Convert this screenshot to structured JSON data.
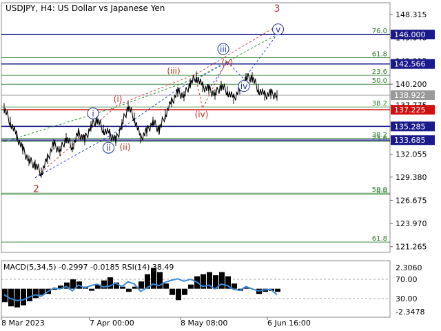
{
  "header": {
    "symbol": "USDJPY",
    "timeframe": "H4",
    "description": "US Dollar vs Japanese Yen"
  },
  "chart_data": {
    "type": "line",
    "symbol": "USDJPY",
    "timeframe": "H4",
    "x_labels": [
      "8 Mar 2023",
      "7 Apr 00:00",
      "8 May 08:00",
      "6 Jun 16:00"
    ],
    "price_axis": {
      "ylim": [
        120.6,
        149.7
      ],
      "ticks": [
        "148.315",
        "145.640",
        "142.915",
        "140.200",
        "137.775",
        "135.320",
        "132.055",
        "129.380",
        "126.675",
        "123.970",
        "121.265"
      ]
    },
    "price_series": {
      "x": [
        0,
        3,
        6,
        9,
        12,
        15,
        18,
        21,
        24,
        27,
        30,
        33,
        36,
        39,
        42,
        45,
        48,
        51,
        54,
        57,
        60,
        63,
        66,
        69,
        72,
        75,
        78,
        81,
        84,
        87,
        90,
        93,
        96,
        99,
        102,
        105,
        108,
        111,
        114,
        117,
        120,
        123,
        126,
        129,
        132
      ],
      "y": [
        137.4,
        135.8,
        134.2,
        132.6,
        131.3,
        130.8,
        129.9,
        131.5,
        133.2,
        132.4,
        133.9,
        132.9,
        134.5,
        133.7,
        135.3,
        136.1,
        134.9,
        134.4,
        133.6,
        135.5,
        137.6,
        136.3,
        133.9,
        134.7,
        135.8,
        134.9,
        136.7,
        138.1,
        139.3,
        138.8,
        140.3,
        141.1,
        139.9,
        139.6,
        139.0,
        140.0,
        139.4,
        138.5,
        139.6,
        140.9,
        141.0,
        139.6,
        138.9,
        139.1,
        138.9
      ]
    },
    "horizontal_levels": [
      {
        "price": 146.0,
        "label": "146.000",
        "color": "#1a1a8c",
        "badge": true
      },
      {
        "price": 142.566,
        "label": "142.566",
        "color": "#1a1a8c",
        "badge": true
      },
      {
        "price": 138.922,
        "label": "138.922",
        "color": "#9a9a9a",
        "badge": true
      },
      {
        "price": 137.225,
        "label": "137.225",
        "color": "#d01010",
        "badge": true
      },
      {
        "price": 135.285,
        "label": "135.285",
        "color": "#1a1a8c",
        "badge": true
      },
      {
        "price": 133.685,
        "label": "133.685",
        "color": "#1a1a8c",
        "badge": true
      }
    ],
    "fib_levels": [
      {
        "price": 146.0,
        "label": "76.0"
      },
      {
        "price": 143.3,
        "label": "61.8"
      },
      {
        "price": 141.25,
        "label": "23.6"
      },
      {
        "price": 140.2,
        "label": "50.0"
      },
      {
        "price": 137.55,
        "label": "38.2"
      },
      {
        "price": 133.9,
        "label": "38.2"
      },
      {
        "price": 133.5,
        "label": "23.6"
      },
      {
        "price": 127.5,
        "label": "50.0"
      },
      {
        "price": 127.3,
        "label": "0.0"
      },
      {
        "price": 121.8,
        "label": "61.8"
      }
    ],
    "wave_labels": [
      {
        "text": "3",
        "x": 132.0,
        "y": 149.0,
        "color": "#b03030",
        "style": "plain"
      },
      {
        "text": "v",
        "x": 132.5,
        "y": 146.6,
        "color": "#2030a0",
        "style": "circle"
      },
      {
        "text": "iii",
        "x": 106.0,
        "y": 144.3,
        "color": "#2030a0",
        "style": "circle"
      },
      {
        "text": "(v)",
        "x": 108.0,
        "y": 142.8,
        "color": "#c03020",
        "style": "paren"
      },
      {
        "text": "iv",
        "x": 116.0,
        "y": 140.0,
        "color": "#2030a0",
        "style": "circle"
      },
      {
        "text": "(iii)",
        "x": 82.0,
        "y": 141.8,
        "color": "#c03020",
        "style": "paren"
      },
      {
        "text": "(iv)",
        "x": 95.5,
        "y": 136.7,
        "color": "#c03020",
        "style": "paren"
      },
      {
        "text": "(i)",
        "x": 55.0,
        "y": 138.5,
        "color": "#c03020",
        "style": "paren"
      },
      {
        "text": "i",
        "x": 43.0,
        "y": 136.8,
        "color": "#2030a0",
        "style": "circle"
      },
      {
        "text": "ii",
        "x": 50.5,
        "y": 132.8,
        "color": "#2030a0",
        "style": "circle"
      },
      {
        "text": "(ii)",
        "x": 58.5,
        "y": 132.9,
        "color": "#c03020",
        "style": "paren"
      },
      {
        "text": "2",
        "x": 15.5,
        "y": 128.0,
        "color": "#b03030",
        "style": "plain"
      }
    ],
    "projection_lines": [
      {
        "points": [
          [
            99,
            139.6
          ],
          [
            108,
            142.8
          ],
          [
            116,
            140.8
          ],
          [
            132,
            146.0
          ]
        ],
        "color": "#2040d0"
      },
      {
        "points": [
          [
            93,
            140.6
          ],
          [
            96,
            137.4
          ],
          [
            108,
            143.1
          ]
        ],
        "color": "#d03030"
      },
      {
        "points": [
          [
            15,
            129.3
          ],
          [
            55,
            137.8
          ],
          [
            93,
            141.4
          ],
          [
            132,
            147.0
          ]
        ],
        "color": "#d04040"
      },
      {
        "points": [
          [
            0,
            133.5
          ],
          [
            55,
            137.6
          ],
          [
            93,
            140.9
          ],
          [
            132,
            146.0
          ]
        ],
        "color": "#2a8a2a"
      },
      {
        "points": [
          [
            15,
            129.3
          ],
          [
            52,
            134.3
          ],
          [
            84,
            139.6
          ],
          [
            108,
            142.8
          ]
        ],
        "color": "#2040d0"
      }
    ],
    "indicator": {
      "label": "MACD(5,34,5) -0.2997 -0.0185 RSI(14) 38.49",
      "ticks": [
        "2.3060",
        "70.00",
        "30.00",
        "-2.3478"
      ],
      "macd_hist": [
        -1.3,
        -1.7,
        -1.8,
        -1.6,
        -1.2,
        -0.9,
        -0.6,
        -0.5,
        -0.1,
        0.3,
        0.6,
        0.9,
        0.7,
        0.2,
        -0.2,
        0.4,
        0.8,
        1.1,
        0.6,
        0.2,
        -0.3,
        0.2,
        0.7,
        1.4,
        2.0,
        1.6,
        0.5,
        -0.6,
        -1.1,
        -0.6,
        0.4,
        1.2,
        1.4,
        1.6,
        1.3,
        1.6,
        1.2,
        0.5,
        -0.2,
        0.1,
        0.0,
        -0.5,
        -0.3,
        -0.2,
        -0.3
      ],
      "rsi": [
        38,
        30,
        26,
        27,
        33,
        38,
        35,
        44,
        52,
        50,
        55,
        46,
        58,
        52,
        57,
        60,
        54,
        56,
        62,
        55,
        65,
        60,
        45,
        52,
        60,
        57,
        64,
        68,
        71,
        66,
        70,
        65,
        55,
        58,
        50,
        60,
        57,
        49,
        47,
        55,
        50,
        46,
        48,
        49,
        38
      ]
    }
  }
}
